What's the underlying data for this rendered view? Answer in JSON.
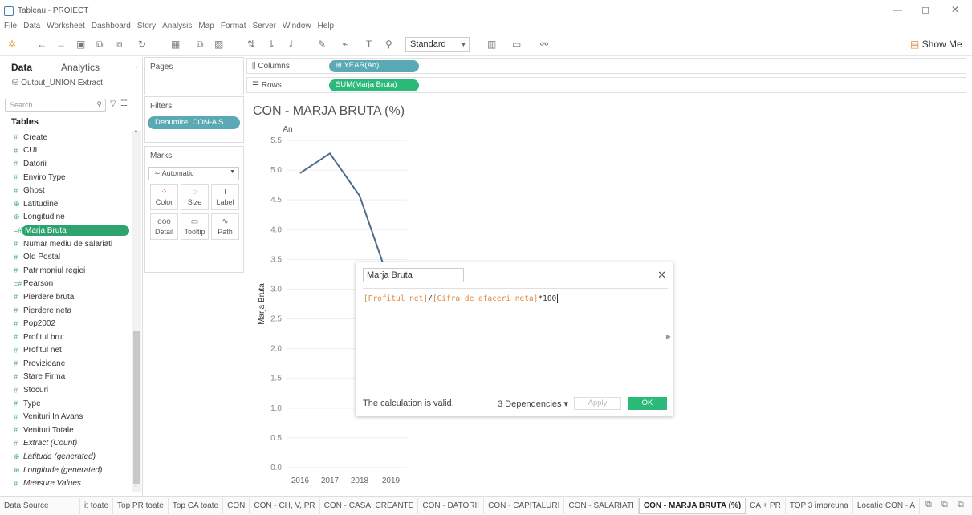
{
  "window": {
    "title": "Tableau - PROIECT",
    "minimize": "—",
    "restore": "◻",
    "close": "✕"
  },
  "menu": [
    "File",
    "Data",
    "Worksheet",
    "Dashboard",
    "Story",
    "Analysis",
    "Map",
    "Format",
    "Server",
    "Window",
    "Help"
  ],
  "toolbar": {
    "fit_select": "Standard",
    "show_me": "Show Me"
  },
  "datapane": {
    "tab_data": "Data",
    "tab_analytics": "Analytics",
    "datasource": "Output_UNION Extract",
    "search_placeholder": "Search",
    "tables_heading": "Tables",
    "fields": [
      {
        "type": "#",
        "name": "Create",
        "italic": false
      },
      {
        "type": "#",
        "name": "CUI",
        "italic": false
      },
      {
        "type": "#",
        "name": "Datorii",
        "italic": false
      },
      {
        "type": "#",
        "name": "Enviro Type",
        "italic": false
      },
      {
        "type": "#",
        "name": "Ghost",
        "italic": false
      },
      {
        "type": "⊕",
        "name": "Latitudine",
        "italic": false
      },
      {
        "type": "⊕",
        "name": "Longitudine",
        "italic": false
      },
      {
        "type": "=#",
        "name": "Marja Bruta",
        "italic": false,
        "selected": true
      },
      {
        "type": "#",
        "name": "Numar mediu de salariati",
        "italic": false
      },
      {
        "type": "#",
        "name": "Old Postal",
        "italic": false
      },
      {
        "type": "#",
        "name": "Patrimoniul regiei",
        "italic": false
      },
      {
        "type": "=#",
        "name": "Pearson",
        "italic": false
      },
      {
        "type": "#",
        "name": "Pierdere bruta",
        "italic": false
      },
      {
        "type": "#",
        "name": "Pierdere neta",
        "italic": false
      },
      {
        "type": "#",
        "name": "Pop2002",
        "italic": false
      },
      {
        "type": "#",
        "name": "Profitul brut",
        "italic": false
      },
      {
        "type": "#",
        "name": "Profitul net",
        "italic": false
      },
      {
        "type": "#",
        "name": "Provizioane",
        "italic": false
      },
      {
        "type": "#",
        "name": "Stare Firma",
        "italic": false
      },
      {
        "type": "#",
        "name": "Stocuri",
        "italic": false
      },
      {
        "type": "#",
        "name": "Type",
        "italic": false
      },
      {
        "type": "#",
        "name": "Venituri In Avans",
        "italic": false
      },
      {
        "type": "#",
        "name": "Venituri Totale",
        "italic": false
      },
      {
        "type": "#",
        "name": "Extract (Count)",
        "italic": true
      },
      {
        "type": "⊕",
        "name": "Latitude (generated)",
        "italic": true
      },
      {
        "type": "⊕",
        "name": "Longitude (generated)",
        "italic": true
      },
      {
        "type": "#",
        "name": "Measure Values",
        "italic": true
      }
    ]
  },
  "cards": {
    "pages": "Pages",
    "filters": "Filters",
    "filter_pill": "Denumire: CON-A S..",
    "marks": "Marks",
    "mark_type": "Automatic",
    "mark_buttons": [
      {
        "icon": "⁘",
        "label": "Color"
      },
      {
        "icon": "◌",
        "label": "Size"
      },
      {
        "icon": "T",
        "label": "Label"
      },
      {
        "icon": "ooo",
        "label": "Detail"
      },
      {
        "icon": "▭",
        "label": "Tooltip"
      },
      {
        "icon": "∿",
        "label": "Path"
      }
    ]
  },
  "shelves": {
    "columns_label": "Columns",
    "columns_pill": "YEAR(An)",
    "rows_label": "Rows",
    "rows_pill": "SUM(Marja Bruta)"
  },
  "chart_title": "CON - MARJA BRUTA (%)",
  "chart_data": {
    "type": "line",
    "title": "CON - MARJA BRUTA (%)",
    "xlabel": "An",
    "ylabel": "Marja Bruta",
    "categories": [
      "2016",
      "2017",
      "2018",
      "2019"
    ],
    "series": [
      {
        "name": "Marja Bruta",
        "values": [
          4.95,
          5.28,
          4.57,
          3.05
        ]
      }
    ],
    "ylim": [
      0,
      5.5
    ],
    "yticks": [
      "0.0",
      "0.5",
      "1.0",
      "1.5",
      "2.0",
      "2.5",
      "3.0",
      "3.5",
      "4.0",
      "4.5",
      "5.0",
      "5.5"
    ],
    "color": "#4e6d8e",
    "grid": true
  },
  "calc_dialog": {
    "name": "Marja Bruta",
    "formula_field1": "[Profitul net]",
    "formula_slash": "/",
    "formula_field2": "[Cifra de afaceri neta]",
    "formula_tail": "*100",
    "status": "The calculation is valid.",
    "dependencies": "3 Dependencies ▾",
    "apply": "Apply",
    "ok": "OK"
  },
  "sheet_tabs": [
    {
      "label": "Data Source",
      "active": false
    },
    {
      "label": "it toate",
      "active": false
    },
    {
      "label": "Top PR toate",
      "active": false
    },
    {
      "label": "Top CA toate",
      "active": false
    },
    {
      "label": "CON",
      "active": false
    },
    {
      "label": "CON - CH, V, PR",
      "active": false
    },
    {
      "label": "CON - CASA, CREANTE",
      "active": false
    },
    {
      "label": "CON - DATORII",
      "active": false
    },
    {
      "label": "CON - CAPITALURI",
      "active": false
    },
    {
      "label": "CON - SALARIATI",
      "active": false
    },
    {
      "label": "CON - MARJA BRUTA (%)",
      "active": true
    },
    {
      "label": "CA + PR",
      "active": false
    },
    {
      "label": "TOP 3 impreuna",
      "active": false
    },
    {
      "label": "Locatie CON - A",
      "active": false
    }
  ],
  "colors": {
    "accent_green": "#2ea36f",
    "filter_pill": "#5ba9b4",
    "line": "#4e6d8e",
    "formula_field": "#e0883c"
  }
}
